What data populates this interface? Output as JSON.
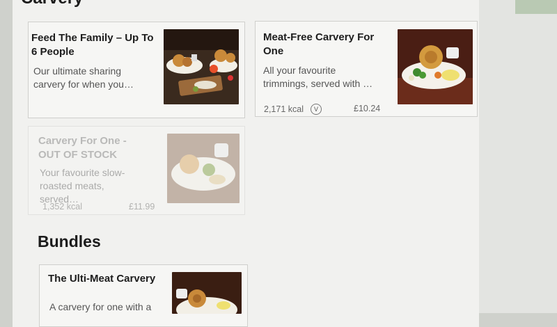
{
  "sections": {
    "carvery_title": "Carvery",
    "bundles_title": "Bundles"
  },
  "cards": [
    {
      "title": "Feed The Family – Up To 6 People",
      "description": "Our ultimate sharing carvery for when you…",
      "kcal": "",
      "price": ""
    },
    {
      "title": "Meat-Free Carvery For One",
      "description": "All your favourite trimmings, served with …",
      "kcal": "2,171 kcal",
      "veg": "V",
      "price": "£10.24"
    },
    {
      "title": "Carvery For One - OUT OF STOCK",
      "description": "Your favourite slow-roasted meats, served…",
      "kcal": "1,352 kcal",
      "price": "£11.99"
    },
    {
      "title": "The Ulti-Meat Carvery",
      "description": "A carvery for one with a",
      "kcal": "",
      "price": ""
    }
  ],
  "colors": {
    "page_bg": "#f1f1ef",
    "card_bg": "#f6f6f4",
    "border": "#cfcfcc"
  }
}
